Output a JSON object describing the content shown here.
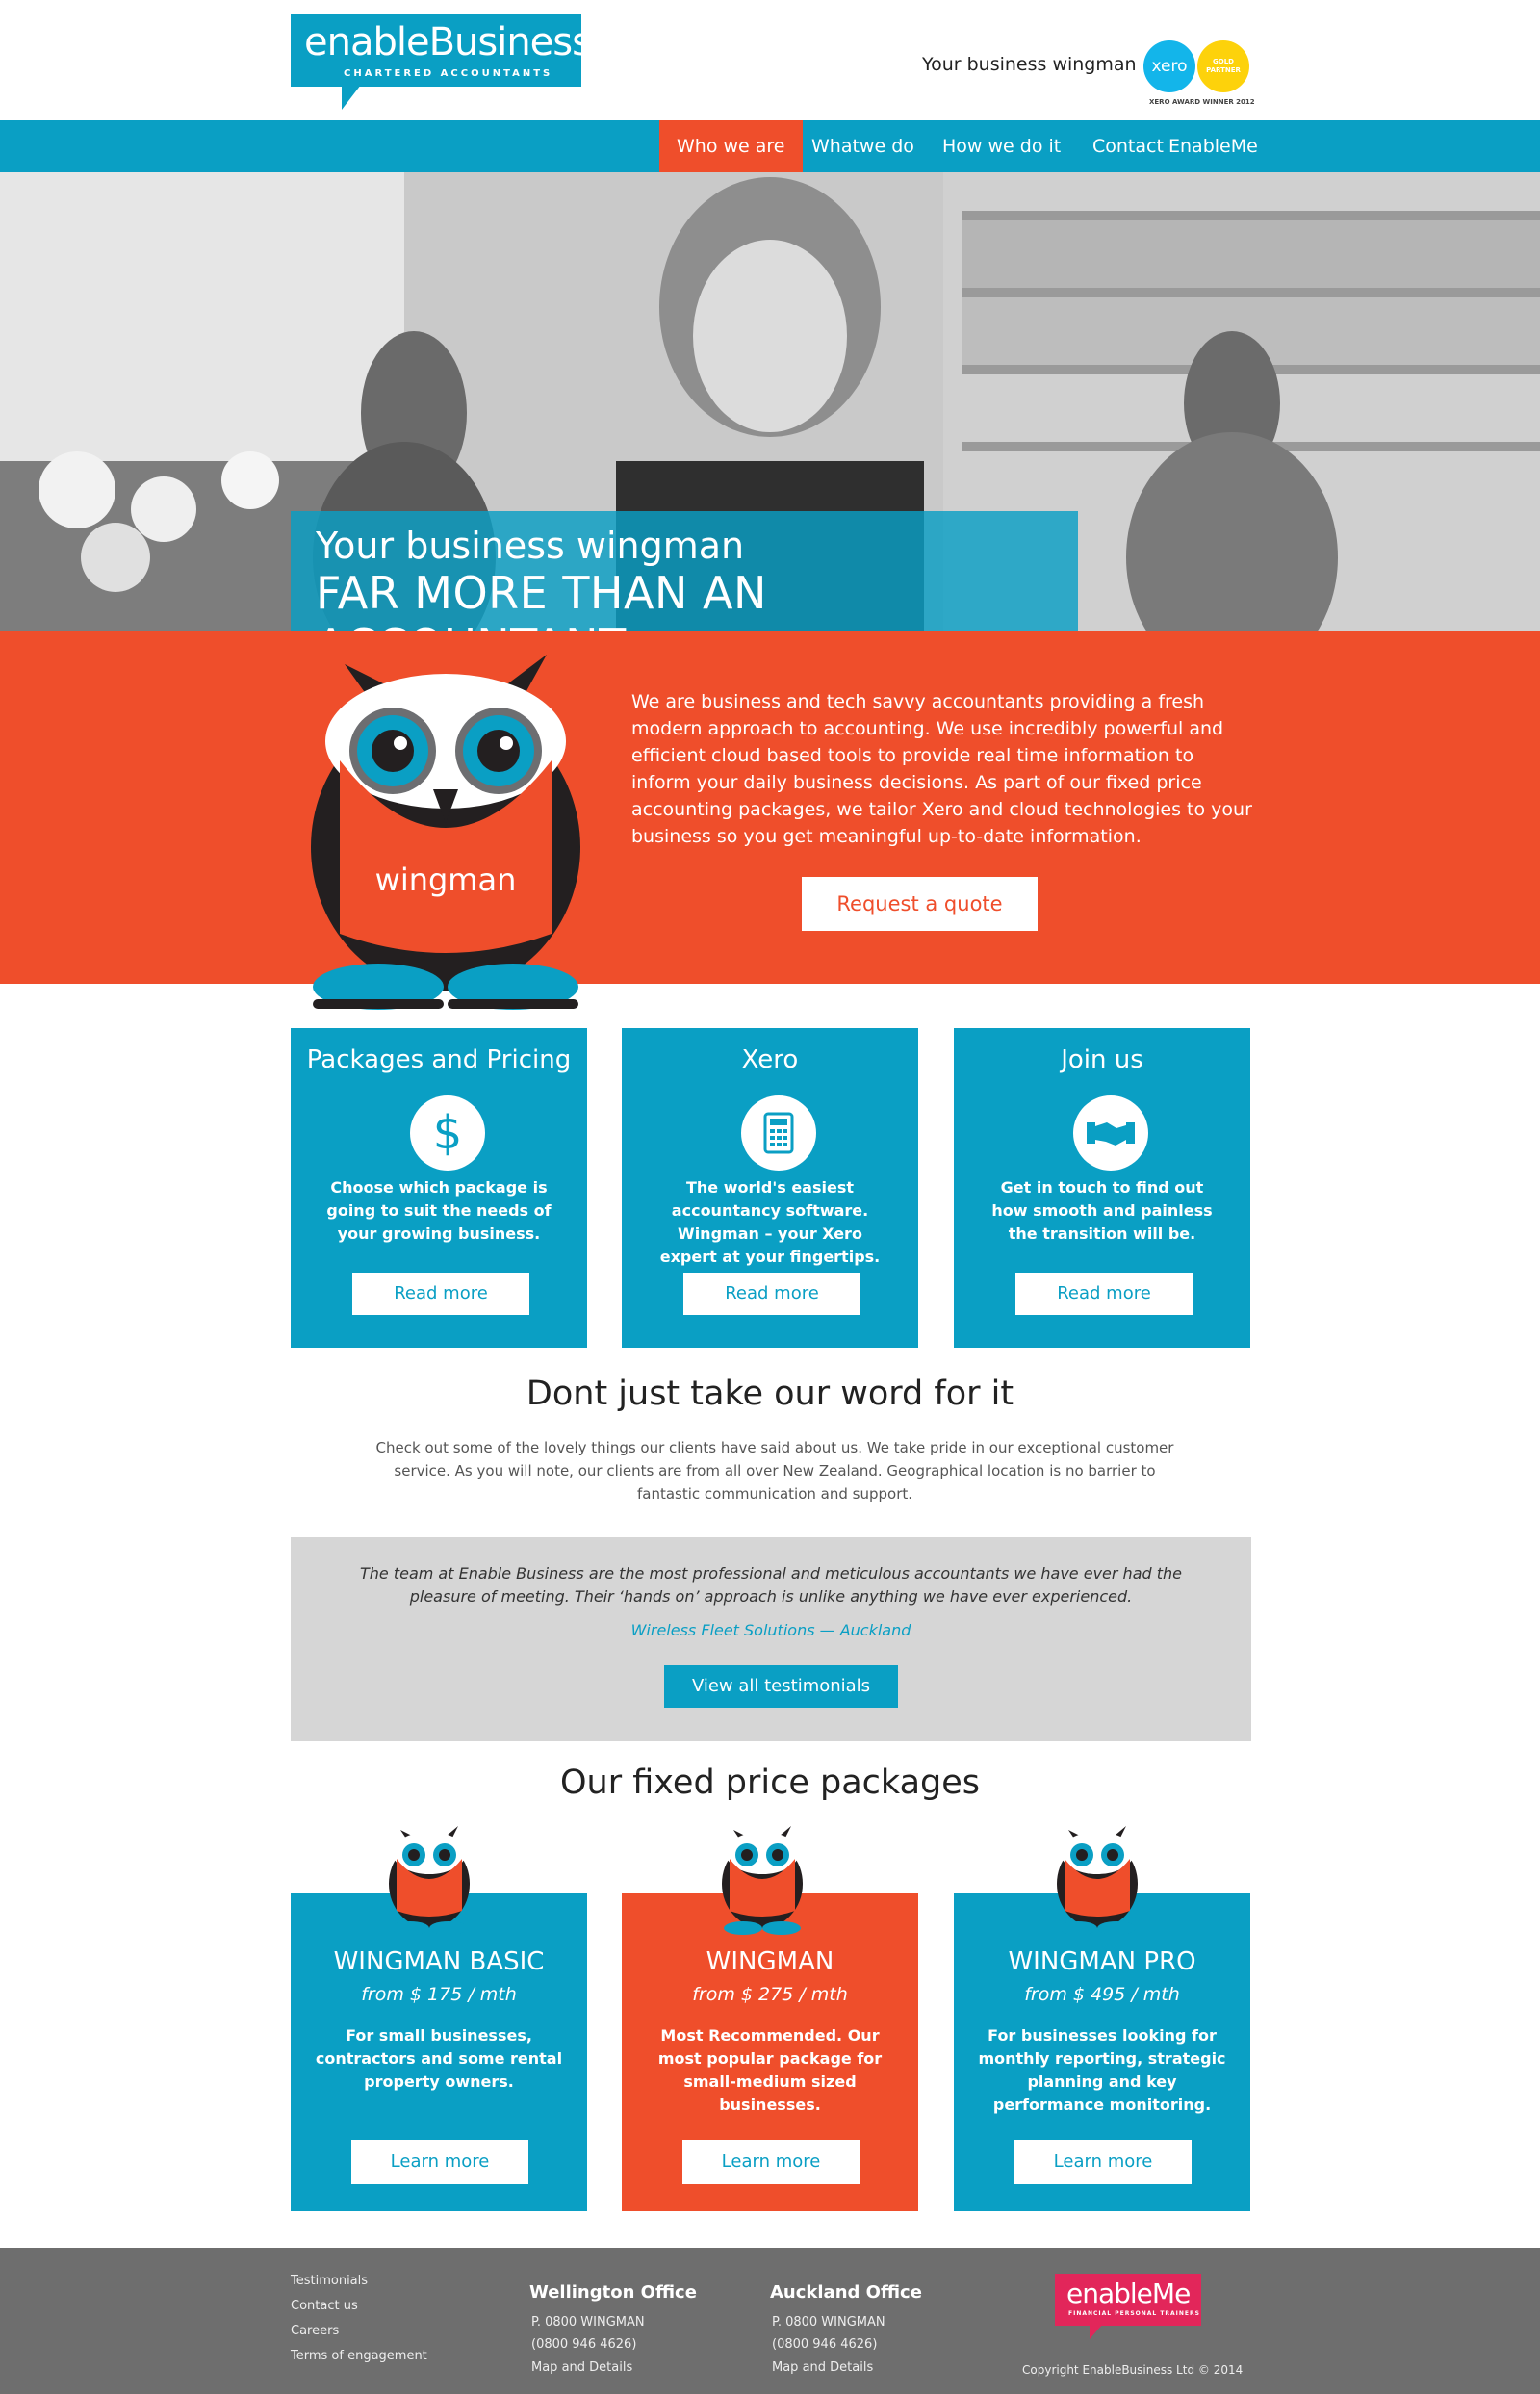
{
  "header": {
    "logo_main": "enableBusiness",
    "logo_sub": "CHARTERED ACCOUNTANTS",
    "tagline": "Your business wingman",
    "xero_logo": "xero",
    "gold_partner": "GOLD PARTNER",
    "xero_award": "XERO AWARD WINNER 2012"
  },
  "nav": {
    "items": [
      {
        "label": "Who we are",
        "active": true
      },
      {
        "label": "Whatwe do",
        "active": false
      },
      {
        "label": "How we do it",
        "active": false
      },
      {
        "label": "Contact",
        "active": false
      },
      {
        "label": "EnableMe",
        "active": false
      }
    ]
  },
  "hero": {
    "line1": "Your business wingman",
    "line2": "FAR MORE THAN AN ACCOUNTANT"
  },
  "intro": {
    "text": "We are business and tech savvy accountants providing a fresh modern approach to accounting. We use incredibly powerful and efficient cloud based tools to provide real time information to inform your daily business decisions. As part of our fixed price accounting packages, we tailor Xero and cloud technologies to your business so you get meaningful up-to-date information.",
    "button": "Request a quote",
    "owl_label": "wingman"
  },
  "cards": [
    {
      "title": "Packages and Pricing",
      "icon": "dollar-icon",
      "text": "Choose which package is going to suit the needs of your growing business.",
      "button": "Read more"
    },
    {
      "title": "Xero",
      "icon": "calculator-icon",
      "text": "The world's easiest accountancy software. Wingman – your Xero expert at your fingertips.",
      "button": "Read more"
    },
    {
      "title": "Join us",
      "icon": "handshake-icon",
      "text": "Get in touch to find out how smooth and painless the transition will be.",
      "button": "Read more"
    }
  ],
  "testimonials": {
    "title": "Dont just take our word for it",
    "intro": "Check out some of the lovely things our clients have said about us. We take pride in our exceptional customer service. As you will note, our clients are from all over New Zealand. Geographical location is no barrier to fantastic communication and support.",
    "quote": "The team at Enable Business are the most professional and meticulous accountants we have ever had the pleasure of meeting. Their ‘hands on’ approach is unlike anything we have ever experienced.",
    "author": "Wireless Fleet Solutions — Auckland",
    "button": "View all testimonials"
  },
  "packages": {
    "title": "Our fixed price packages",
    "items": [
      {
        "name": "WINGMAN BASIC",
        "price": "from $ 175 / mth",
        "desc": "For small businesses, contractors and some rental property owners.",
        "button": "Learn more",
        "color": "#0a9fc4"
      },
      {
        "name": "WINGMAN",
        "price": "from $ 275 / mth",
        "desc": "Most Recommended. Our most popular package for small-medium sized businesses.",
        "button": "Learn more",
        "color": "#ef4e2b"
      },
      {
        "name": "WINGMAN PRO",
        "price": "from $ 495 / mth",
        "desc": "For businesses looking for monthly reporting, strategic planning and key performance monitoring.",
        "button": "Learn more",
        "color": "#0a9fc4"
      }
    ]
  },
  "footer": {
    "links": [
      "Testimonials",
      "Contact us",
      "Careers",
      "Terms of engagement"
    ],
    "wellington": {
      "title": "Wellington Office",
      "phone": "P. 0800 WINGMAN",
      "number": "(0800 946 4626)",
      "map": "Map and Details"
    },
    "auckland": {
      "title": "Auckland Office",
      "phone": "P. 0800 WINGMAN",
      "number": "(0800 946 4626)",
      "map": "Map and Details"
    },
    "enableme_main": "enableMe",
    "enableme_sub": "FINANCIAL PERSONAL TRAINERS",
    "copyright": "Copyright EnableBusiness Ltd © 2014"
  },
  "colors": {
    "primary_blue": "#0a9fc4",
    "accent_orange": "#ef4e2b",
    "footer_gray": "#6e6e6e",
    "enableme_pink": "#e2265a"
  }
}
